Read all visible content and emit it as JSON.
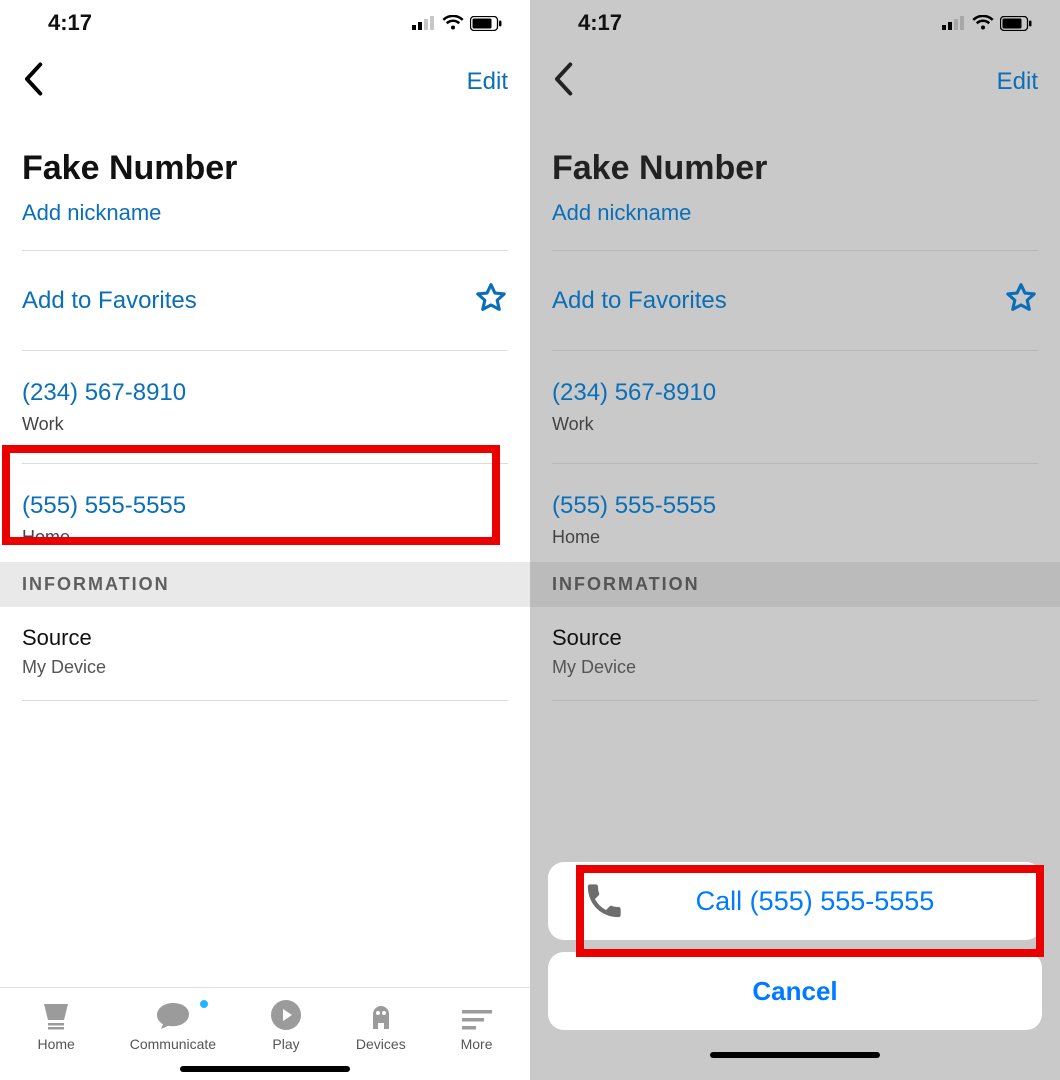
{
  "status": {
    "time": "4:17"
  },
  "nav": {
    "edit": "Edit"
  },
  "contact": {
    "name": "Fake Number",
    "add_nickname": "Add nickname",
    "favorites_label": "Add to Favorites",
    "numbers": [
      {
        "value": "(234) 567-8910",
        "label": "Work"
      },
      {
        "value": "(555) 555-5555",
        "label": "Home"
      }
    ]
  },
  "info": {
    "header": "INFORMATION",
    "source_label": "Source",
    "source_value": "My Device"
  },
  "tabs": {
    "home": "Home",
    "communicate": "Communicate",
    "play": "Play",
    "devices": "Devices",
    "more": "More"
  },
  "sheet": {
    "call_label": "Call (555) 555-5555",
    "cancel": "Cancel"
  }
}
